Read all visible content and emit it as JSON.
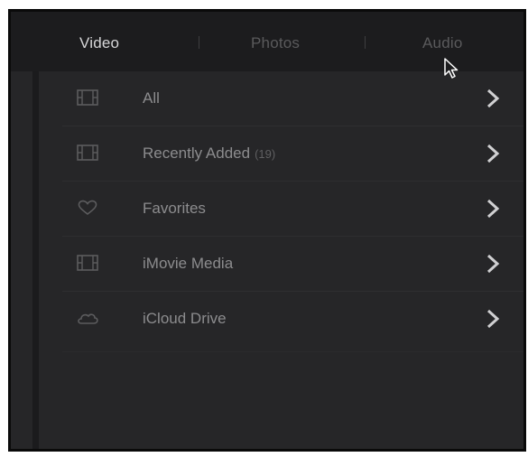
{
  "tabs": [
    {
      "label": "Video",
      "active": true
    },
    {
      "label": "Photos",
      "active": false
    },
    {
      "label": "Audio",
      "active": false
    }
  ],
  "list": {
    "items": [
      {
        "label": "All",
        "count": "",
        "icon": "film-icon"
      },
      {
        "label": "Recently Added",
        "count": "(19)",
        "icon": "film-icon"
      },
      {
        "label": "Favorites",
        "count": "",
        "icon": "heart-icon"
      },
      {
        "label": "iMovie Media",
        "count": "",
        "icon": "film-icon"
      },
      {
        "label": "iCloud Drive",
        "count": "",
        "icon": "cloud-icon"
      }
    ]
  },
  "colors": {
    "background": "#262628",
    "tab_bar": "#1c1c1e",
    "active_tab": "#d6d6d8",
    "inactive_tab": "#5a5a5c",
    "label": "#8c8c8e",
    "chevron": "#d0d0d2"
  }
}
